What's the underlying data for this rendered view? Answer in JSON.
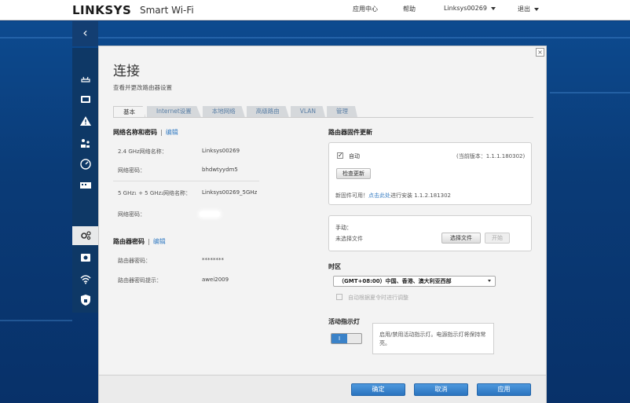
{
  "header": {
    "brand": "LINKSYS",
    "product": "Smart Wi-Fi",
    "app_center": "应用中心",
    "help": "帮助",
    "account": "Linksys00269",
    "logout": "退出"
  },
  "page": {
    "title": "连接",
    "subtitle": "查看并更改路由器设置"
  },
  "tabs": [
    "基本",
    "Internet设置",
    "本地网络",
    "高级路由",
    "VLAN",
    "管理"
  ],
  "wifi": {
    "section_title": "网络名称和密码",
    "edit": "编辑",
    "band24_label": "2.4 GHz网络名称：",
    "band24_value": "Linksys00269",
    "pass1_label": "网络密码：",
    "pass1_value": "bhdwtyydm5",
    "band5_label": "5 GHz₁ + 5 GHz₂网络名称：",
    "band5_value": "Linksys00269_5GHz",
    "pass2_label": "网络密码："
  },
  "router_password": {
    "section_title": "路由器密码",
    "edit": "编辑",
    "pass_label": "路由器密码：",
    "pass_value": "********",
    "hint_label": "路由器密码提示：",
    "hint_value": "awei2009"
  },
  "firmware": {
    "section_title": "路由器固件更新",
    "auto_label": "自动",
    "auto_checked": true,
    "current_version": "(当前版本：1.1.1.180302)",
    "check_button": "检查更新",
    "new_available": "新固件可用！",
    "click_here": "点击此处",
    "install_text": "进行安装 1.1.2.181302",
    "manual_label": "手动：",
    "no_file": "未选择文件",
    "choose_file": "选择文件",
    "start": "开始"
  },
  "timezone": {
    "section_title": "时区",
    "selected": "（GMT+08:00）中国、香港、澳大利亚西部",
    "dst_label": "自动根据夏令时进行调整",
    "dst_checked": false
  },
  "activity_light": {
    "section_title": "活动指示灯",
    "toggle_label": "I",
    "enabled": true,
    "description": "启用/禁用活动指示灯。电源指示灯将保持常亮。"
  },
  "footer": {
    "ok": "确定",
    "cancel": "取消",
    "apply": "应用"
  },
  "colors": {
    "accent": "#3a82c8",
    "link": "#3a7fc4",
    "background": "#0a3a78"
  }
}
